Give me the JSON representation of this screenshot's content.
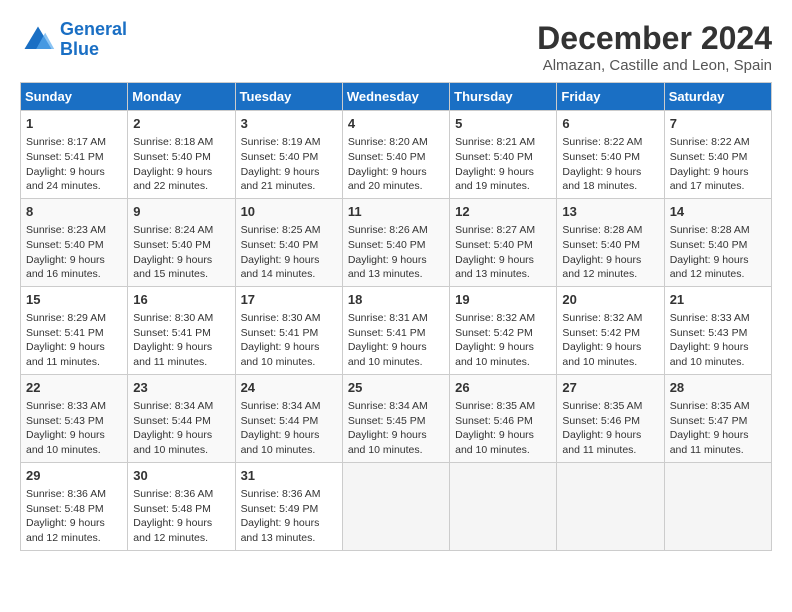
{
  "header": {
    "logo_line1": "General",
    "logo_line2": "Blue",
    "title": "December 2024",
    "subtitle": "Almazan, Castille and Leon, Spain"
  },
  "columns": [
    "Sunday",
    "Monday",
    "Tuesday",
    "Wednesday",
    "Thursday",
    "Friday",
    "Saturday"
  ],
  "weeks": [
    [
      {
        "day": "1",
        "lines": [
          "Sunrise: 8:17 AM",
          "Sunset: 5:41 PM",
          "Daylight: 9 hours",
          "and 24 minutes."
        ]
      },
      {
        "day": "2",
        "lines": [
          "Sunrise: 8:18 AM",
          "Sunset: 5:40 PM",
          "Daylight: 9 hours",
          "and 22 minutes."
        ]
      },
      {
        "day": "3",
        "lines": [
          "Sunrise: 8:19 AM",
          "Sunset: 5:40 PM",
          "Daylight: 9 hours",
          "and 21 minutes."
        ]
      },
      {
        "day": "4",
        "lines": [
          "Sunrise: 8:20 AM",
          "Sunset: 5:40 PM",
          "Daylight: 9 hours",
          "and 20 minutes."
        ]
      },
      {
        "day": "5",
        "lines": [
          "Sunrise: 8:21 AM",
          "Sunset: 5:40 PM",
          "Daylight: 9 hours",
          "and 19 minutes."
        ]
      },
      {
        "day": "6",
        "lines": [
          "Sunrise: 8:22 AM",
          "Sunset: 5:40 PM",
          "Daylight: 9 hours",
          "and 18 minutes."
        ]
      },
      {
        "day": "7",
        "lines": [
          "Sunrise: 8:22 AM",
          "Sunset: 5:40 PM",
          "Daylight: 9 hours",
          "and 17 minutes."
        ]
      }
    ],
    [
      {
        "day": "8",
        "lines": [
          "Sunrise: 8:23 AM",
          "Sunset: 5:40 PM",
          "Daylight: 9 hours",
          "and 16 minutes."
        ]
      },
      {
        "day": "9",
        "lines": [
          "Sunrise: 8:24 AM",
          "Sunset: 5:40 PM",
          "Daylight: 9 hours",
          "and 15 minutes."
        ]
      },
      {
        "day": "10",
        "lines": [
          "Sunrise: 8:25 AM",
          "Sunset: 5:40 PM",
          "Daylight: 9 hours",
          "and 14 minutes."
        ]
      },
      {
        "day": "11",
        "lines": [
          "Sunrise: 8:26 AM",
          "Sunset: 5:40 PM",
          "Daylight: 9 hours",
          "and 13 minutes."
        ]
      },
      {
        "day": "12",
        "lines": [
          "Sunrise: 8:27 AM",
          "Sunset: 5:40 PM",
          "Daylight: 9 hours",
          "and 13 minutes."
        ]
      },
      {
        "day": "13",
        "lines": [
          "Sunrise: 8:28 AM",
          "Sunset: 5:40 PM",
          "Daylight: 9 hours",
          "and 12 minutes."
        ]
      },
      {
        "day": "14",
        "lines": [
          "Sunrise: 8:28 AM",
          "Sunset: 5:40 PM",
          "Daylight: 9 hours",
          "and 12 minutes."
        ]
      }
    ],
    [
      {
        "day": "15",
        "lines": [
          "Sunrise: 8:29 AM",
          "Sunset: 5:41 PM",
          "Daylight: 9 hours",
          "and 11 minutes."
        ]
      },
      {
        "day": "16",
        "lines": [
          "Sunrise: 8:30 AM",
          "Sunset: 5:41 PM",
          "Daylight: 9 hours",
          "and 11 minutes."
        ]
      },
      {
        "day": "17",
        "lines": [
          "Sunrise: 8:30 AM",
          "Sunset: 5:41 PM",
          "Daylight: 9 hours",
          "and 10 minutes."
        ]
      },
      {
        "day": "18",
        "lines": [
          "Sunrise: 8:31 AM",
          "Sunset: 5:41 PM",
          "Daylight: 9 hours",
          "and 10 minutes."
        ]
      },
      {
        "day": "19",
        "lines": [
          "Sunrise: 8:32 AM",
          "Sunset: 5:42 PM",
          "Daylight: 9 hours",
          "and 10 minutes."
        ]
      },
      {
        "day": "20",
        "lines": [
          "Sunrise: 8:32 AM",
          "Sunset: 5:42 PM",
          "Daylight: 9 hours",
          "and 10 minutes."
        ]
      },
      {
        "day": "21",
        "lines": [
          "Sunrise: 8:33 AM",
          "Sunset: 5:43 PM",
          "Daylight: 9 hours",
          "and 10 minutes."
        ]
      }
    ],
    [
      {
        "day": "22",
        "lines": [
          "Sunrise: 8:33 AM",
          "Sunset: 5:43 PM",
          "Daylight: 9 hours",
          "and 10 minutes."
        ]
      },
      {
        "day": "23",
        "lines": [
          "Sunrise: 8:34 AM",
          "Sunset: 5:44 PM",
          "Daylight: 9 hours",
          "and 10 minutes."
        ]
      },
      {
        "day": "24",
        "lines": [
          "Sunrise: 8:34 AM",
          "Sunset: 5:44 PM",
          "Daylight: 9 hours",
          "and 10 minutes."
        ]
      },
      {
        "day": "25",
        "lines": [
          "Sunrise: 8:34 AM",
          "Sunset: 5:45 PM",
          "Daylight: 9 hours",
          "and 10 minutes."
        ]
      },
      {
        "day": "26",
        "lines": [
          "Sunrise: 8:35 AM",
          "Sunset: 5:46 PM",
          "Daylight: 9 hours",
          "and 10 minutes."
        ]
      },
      {
        "day": "27",
        "lines": [
          "Sunrise: 8:35 AM",
          "Sunset: 5:46 PM",
          "Daylight: 9 hours",
          "and 11 minutes."
        ]
      },
      {
        "day": "28",
        "lines": [
          "Sunrise: 8:35 AM",
          "Sunset: 5:47 PM",
          "Daylight: 9 hours",
          "and 11 minutes."
        ]
      }
    ],
    [
      {
        "day": "29",
        "lines": [
          "Sunrise: 8:36 AM",
          "Sunset: 5:48 PM",
          "Daylight: 9 hours",
          "and 12 minutes."
        ]
      },
      {
        "day": "30",
        "lines": [
          "Sunrise: 8:36 AM",
          "Sunset: 5:48 PM",
          "Daylight: 9 hours",
          "and 12 minutes."
        ]
      },
      {
        "day": "31",
        "lines": [
          "Sunrise: 8:36 AM",
          "Sunset: 5:49 PM",
          "Daylight: 9 hours",
          "and 13 minutes."
        ]
      },
      null,
      null,
      null,
      null
    ]
  ]
}
